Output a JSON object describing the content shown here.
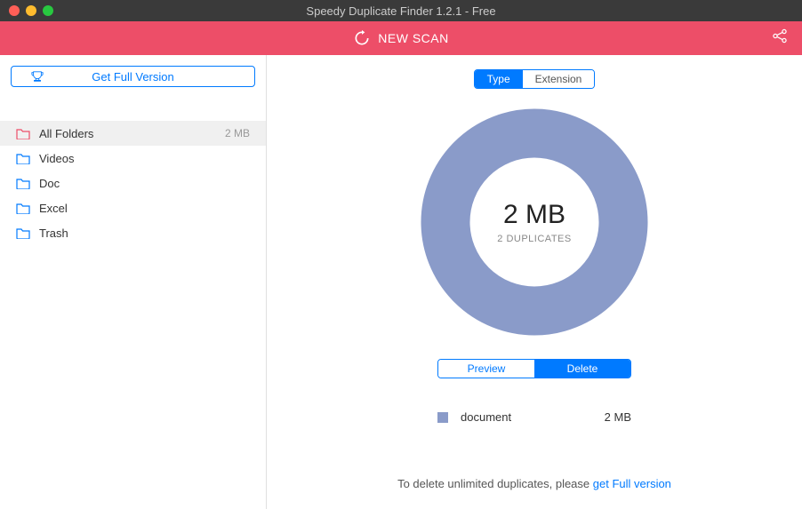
{
  "window": {
    "title": "Speedy Duplicate Finder 1.2.1 - Free"
  },
  "toolbar": {
    "new_scan": "NEW SCAN"
  },
  "sidebar": {
    "get_full_version": "Get Full Version",
    "folders": [
      {
        "label": "All Folders",
        "size": "2 MB",
        "active": true,
        "color": "#ed4e68"
      },
      {
        "label": "Videos",
        "size": "",
        "active": false,
        "color": "#007aff"
      },
      {
        "label": "Doc",
        "size": "",
        "active": false,
        "color": "#007aff"
      },
      {
        "label": "Excel",
        "size": "",
        "active": false,
        "color": "#007aff"
      },
      {
        "label": "Trash",
        "size": "",
        "active": false,
        "color": "#007aff"
      }
    ]
  },
  "segment_top": {
    "type": "Type",
    "extension": "Extension"
  },
  "donut": {
    "size": "2 MB",
    "duplicates": "2 DUPLICATES"
  },
  "segment_actions": {
    "preview": "Preview",
    "delete": "Delete"
  },
  "legend": {
    "label": "document",
    "size": "2 MB",
    "color": "#8a9bc9"
  },
  "footer": {
    "prefix": "To delete unlimited duplicates, please ",
    "link": "get Full version"
  },
  "chart_data": {
    "type": "pie",
    "title": "",
    "series": [
      {
        "name": "document",
        "value": 2,
        "unit": "MB",
        "color": "#8a9bc9"
      }
    ],
    "total_label": "2 MB",
    "subtitle": "2 DUPLICATES"
  }
}
